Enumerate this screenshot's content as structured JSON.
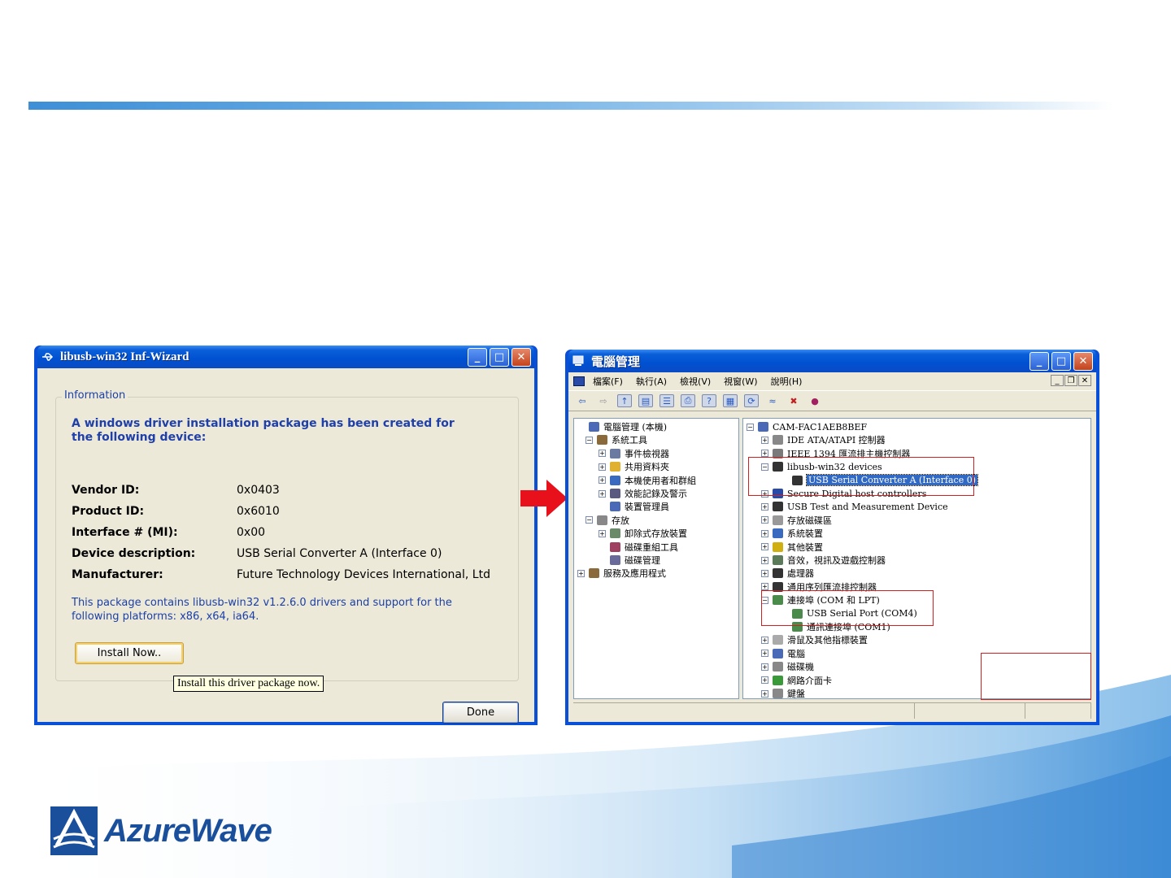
{
  "wizard": {
    "title": "libusb-win32 Inf-Wizard",
    "group_label": "Information",
    "heading": "A windows driver installation package has been created for the following device:",
    "fields": [
      {
        "key": "Vendor ID:",
        "value": "0x0403"
      },
      {
        "key": "Product ID:",
        "value": "0x6010"
      },
      {
        "key": "Interface # (MI):",
        "value": "0x00"
      },
      {
        "key": "Device description:",
        "value": "USB Serial Converter A (Interface 0)"
      },
      {
        "key": "Manufacturer:",
        "value": "Future Technology Devices International, Ltd"
      }
    ],
    "note": "This package contains libusb-win32 v1.2.6.0 drivers and support for the following platforms: x86, x64, ia64.",
    "install_label": "Install Now..",
    "tooltip": "Install this driver package now.",
    "done_label": "Done"
  },
  "devmgr": {
    "title": "電腦管理",
    "menu": [
      "檔案(F)",
      "執行(A)",
      "檢視(V)",
      "視窗(W)",
      "說明(H)"
    ],
    "left_tree": [
      {
        "label": "電腦管理 (本機)",
        "exp": "",
        "icon": "computer-icon"
      },
      {
        "label": "系統工具",
        "exp": "−",
        "icon": "tools-icon"
      },
      {
        "label": "事件檢視器",
        "exp": "+",
        "icon": "event-icon"
      },
      {
        "label": "共用資料夾",
        "exp": "+",
        "icon": "folder-icon"
      },
      {
        "label": "本機使用者和群組",
        "exp": "+",
        "icon": "users-icon"
      },
      {
        "label": "效能記錄及警示",
        "exp": "+",
        "icon": "performance-icon"
      },
      {
        "label": "裝置管理員",
        "exp": "",
        "icon": "device-manager-icon"
      },
      {
        "label": "存放",
        "exp": "−",
        "icon": "storage-icon"
      },
      {
        "label": "卸除式存放裝置",
        "exp": "+",
        "icon": "removable-icon"
      },
      {
        "label": "磁碟重組工具",
        "exp": "",
        "icon": "defrag-icon"
      },
      {
        "label": "磁碟管理",
        "exp": "",
        "icon": "disk-icon"
      },
      {
        "label": "服務及應用程式",
        "exp": "+",
        "icon": "services-icon"
      }
    ],
    "right_tree": [
      {
        "label": "CAM-FAC1AEB8BEF",
        "exp": "−",
        "icon": "computer-icon"
      },
      {
        "label": "IDE ATA/ATAPI 控制器",
        "exp": "+",
        "icon": "ide-icon"
      },
      {
        "label": "IEEE 1394 匯流排主機控制器",
        "exp": "+",
        "icon": "ieee1394-icon"
      },
      {
        "label": "libusb-win32 devices",
        "exp": "−",
        "icon": "usb-icon"
      },
      {
        "label": "USB Serial Converter A (Interface 0)",
        "exp": "",
        "icon": "usb-icon"
      },
      {
        "label": "Secure Digital host controllers",
        "exp": "+",
        "icon": "sd-icon"
      },
      {
        "label": "USB Test and Measurement Device",
        "exp": "+",
        "icon": "usb-icon"
      },
      {
        "label": "存放磁碟區",
        "exp": "+",
        "icon": "volume-icon"
      },
      {
        "label": "系統裝置",
        "exp": "+",
        "icon": "system-icon"
      },
      {
        "label": "其他裝置",
        "exp": "+",
        "icon": "unknown-icon"
      },
      {
        "label": "音效，視訊及遊戲控制器",
        "exp": "+",
        "icon": "sound-icon"
      },
      {
        "label": "處理器",
        "exp": "+",
        "icon": "cpu-icon"
      },
      {
        "label": "通用序列匯流排控制器",
        "exp": "+",
        "icon": "usb-icon"
      },
      {
        "label": "連接埠 (COM 和 LPT)",
        "exp": "−",
        "icon": "port-icon"
      },
      {
        "label": "USB Serial Port (COM4)",
        "exp": "",
        "icon": "port-icon"
      },
      {
        "label": "通訊連接埠 (COM1)",
        "exp": "",
        "icon": "port-icon"
      },
      {
        "label": "滑鼠及其他指標裝置",
        "exp": "+",
        "icon": "mouse-icon"
      },
      {
        "label": "電腦",
        "exp": "+",
        "icon": "pc-icon"
      },
      {
        "label": "磁碟機",
        "exp": "+",
        "icon": "drive-icon"
      },
      {
        "label": "網路介面卡",
        "exp": "+",
        "icon": "network-icon"
      },
      {
        "label": "鍵盤",
        "exp": "+",
        "icon": "keyboard-icon"
      }
    ]
  },
  "logo": {
    "text": "AzureWave"
  },
  "colors": {
    "accent": "#0a4fd8",
    "highlight_box": "#d02020",
    "arrow": "#e8101a",
    "brand": "#1a4f9c"
  }
}
